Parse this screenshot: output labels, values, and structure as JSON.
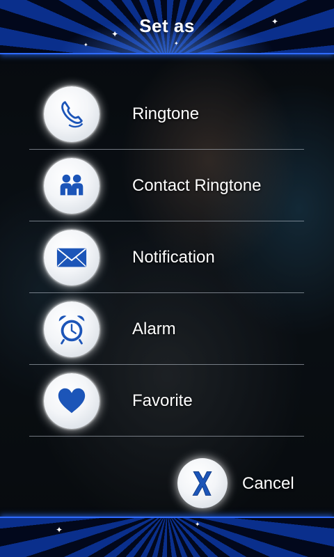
{
  "header": {
    "title": "Set as"
  },
  "menu": {
    "items": [
      {
        "label": "Ringtone",
        "icon": "phone-icon"
      },
      {
        "label": "Contact Ringtone",
        "icon": "contacts-icon"
      },
      {
        "label": "Notification",
        "icon": "envelope-icon"
      },
      {
        "label": "Alarm",
        "icon": "alarm-clock-icon"
      },
      {
        "label": "Favorite",
        "icon": "heart-icon"
      }
    ]
  },
  "cancel": {
    "label": "Cancel",
    "icon": "x-icon"
  },
  "colors": {
    "accent": "#2f6bff",
    "icon_blue": "#1c55b8"
  }
}
